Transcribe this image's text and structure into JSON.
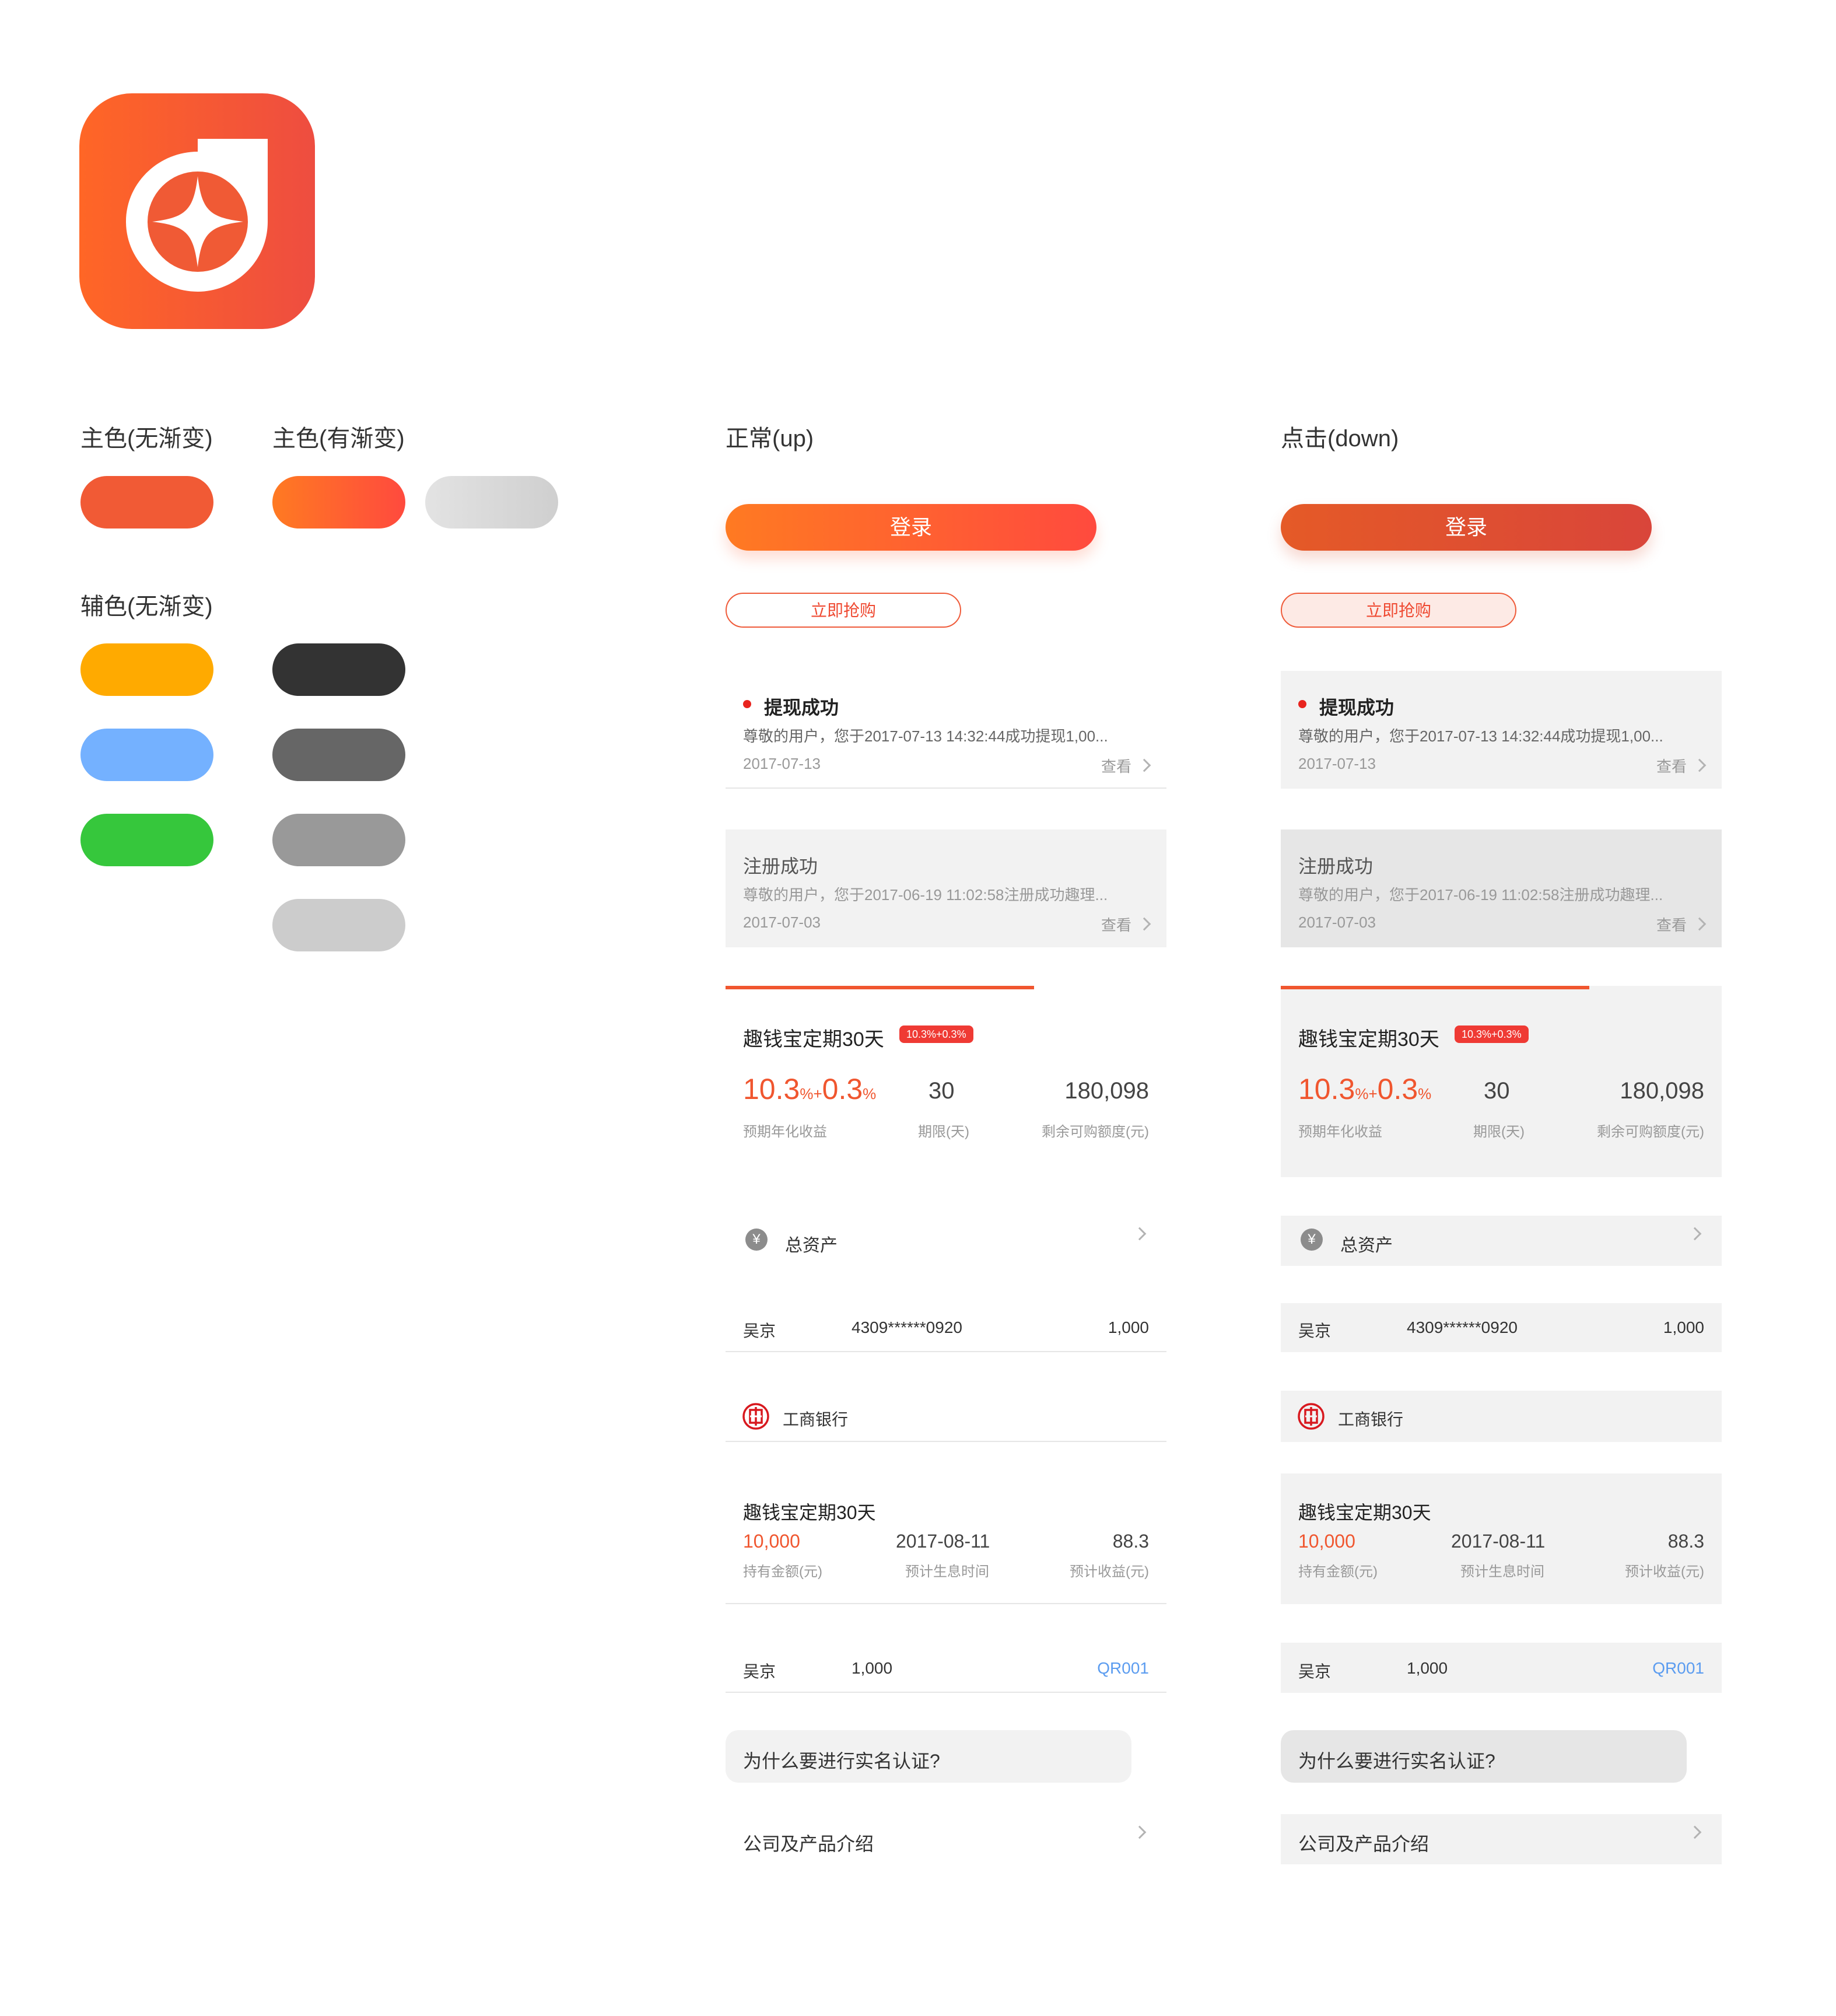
{
  "sections": {
    "primary_flat": "主色(无渐变)",
    "primary_gradient": "主色(有渐变)",
    "secondary_flat": "辅色(无渐变)",
    "state_up": "正常(up)",
    "state_down": "点击(down)"
  },
  "colors": {
    "primary": "#f15a35",
    "primary_gradient": [
      "#ff7a22",
      "#ff4a3e"
    ],
    "disabled_gradient": [
      "#e3e3e3",
      "#cfcfcf"
    ],
    "secondary": [
      "#ffaa00",
      "#74b1ff",
      "#36c73c"
    ],
    "grays": [
      "#333333",
      "#666666",
      "#999999",
      "#cccccc"
    ],
    "down_gradient": [
      "#e55a27",
      "#d9453a"
    ]
  },
  "app_icon": {
    "name": "app-logo-icon"
  },
  "components": {
    "login_button": "登录",
    "buy_button": "立即抢购",
    "msg1": {
      "title": "提现成功",
      "body": "尊敬的用户，您于2017-07-13 14:32:44成功提现1,00...",
      "date": "2017-07-13",
      "link": "查看"
    },
    "msg2": {
      "title": "注册成功",
      "body": "尊敬的用户，您于2017-06-19 11:02:58注册成功趣理...",
      "date": "2017-07-03",
      "link": "查看"
    },
    "product": {
      "name": "趣钱宝定期30天",
      "badge": "10.3%+0.3%",
      "rate_a": "10.3",
      "rate_pct1": "%+",
      "rate_b": "0.3",
      "rate_pct2": "%",
      "rate_caption": "预期年化收益",
      "term": "30",
      "term_caption": "期限(天)",
      "remain": "180,098",
      "remain_caption": "剩余可购额度(元)",
      "progress": 0.7
    },
    "assets": {
      "label": "总资产",
      "icon_char": "¥"
    },
    "person_row": {
      "name": "吴京",
      "id": "4309******0920",
      "amount": "1,000"
    },
    "bank_row": {
      "label": "工商银行"
    },
    "holding": {
      "name": "趣钱宝定期30天",
      "amount": "10,000",
      "amount_caption": "持有金额(元)",
      "date": "2017-08-11",
      "date_caption": "预计生息时间",
      "income": "88.3",
      "income_caption": "预计收益(元)"
    },
    "order_row": {
      "name": "吴京",
      "amount": "1,000",
      "code": "QR001"
    },
    "faq": "为什么要进行实名认证?",
    "company": "公司及产品介绍"
  }
}
